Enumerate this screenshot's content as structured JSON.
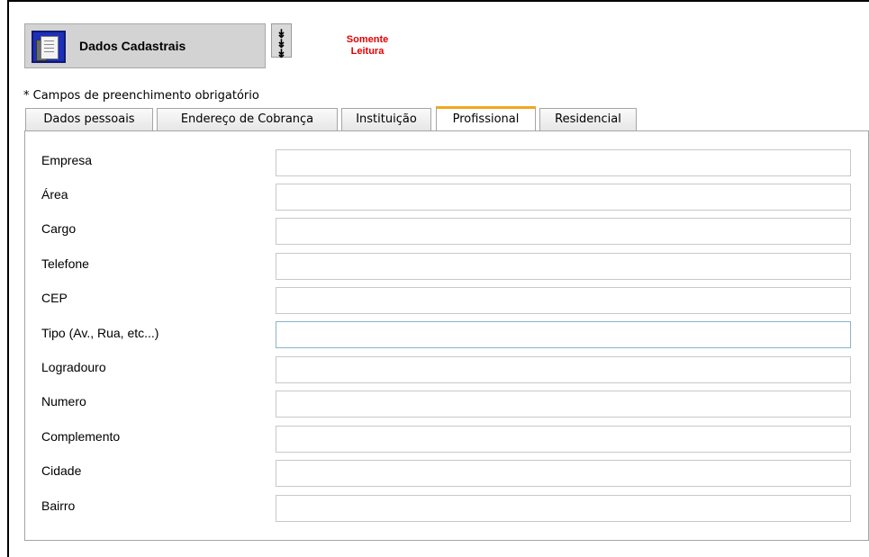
{
  "header": {
    "title": "Dados Cadastrais",
    "icon": "dados-cadastrais-icon",
    "expand_icon": "double-chevron-down-icon",
    "expand_glyph": "»",
    "status_line1": "Somente",
    "status_line2": "Leitura",
    "status_color": "#e60000"
  },
  "form": {
    "required_note": "* Campos de preenchimento obrigatório"
  },
  "tabs": [
    {
      "label": "Dados pessoais",
      "active": false
    },
    {
      "label": "Endereço de Cobrança",
      "active": false
    },
    {
      "label": "Instituição",
      "active": false
    },
    {
      "label": "Profissional",
      "active": true
    },
    {
      "label": "Residencial",
      "active": false
    }
  ],
  "fields": [
    {
      "label": "Empresa",
      "value": ""
    },
    {
      "label": "Área",
      "value": ""
    },
    {
      "label": "Cargo",
      "value": ""
    },
    {
      "label": "Telefone",
      "value": ""
    },
    {
      "label": "CEP",
      "value": ""
    },
    {
      "label": "Tipo (Av., Rua, etc...)",
      "value": ""
    },
    {
      "label": "Logradouro",
      "value": ""
    },
    {
      "label": "Numero",
      "value": ""
    },
    {
      "label": "Complemento",
      "value": ""
    },
    {
      "label": "Cidade",
      "value": ""
    },
    {
      "label": "Bairro",
      "value": ""
    }
  ],
  "colors": {
    "active_tab_accent": "#f0a820",
    "header_background": "#d3d3d3",
    "icon_background": "#1b2fb8"
  }
}
